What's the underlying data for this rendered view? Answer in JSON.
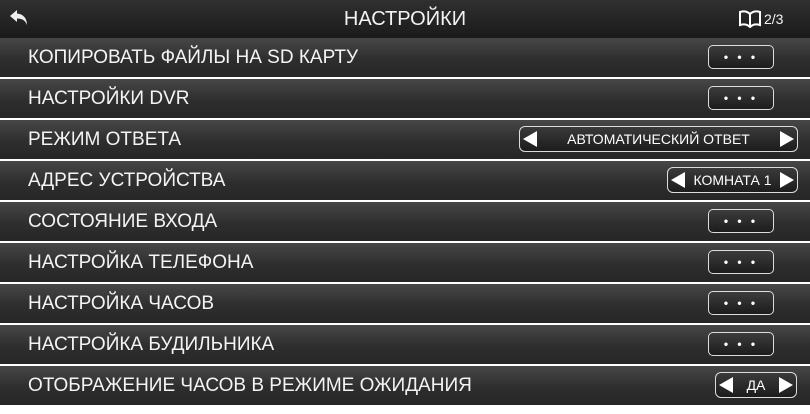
{
  "header": {
    "title": "НАСТРОЙКИ",
    "page_indicator": "2/3",
    "back_icon": "back-arrow-icon",
    "page_icon": "open-book-icon"
  },
  "rows": [
    {
      "label": "КОПИРОВАТЬ ФАЙЛЫ НА SD КАРТУ",
      "button": "• • •"
    },
    {
      "label": "НАСТРОЙКИ DVR",
      "button": "• • •"
    },
    {
      "label": "РЕЖИМ ОТВЕТА",
      "value": "АВТОМАТИЧЕСКИЙ ОТВЕТ"
    },
    {
      "label": "АДРЕС УСТРОЙСТВА",
      "value": "КОМНАТА 1"
    },
    {
      "label": "СОСТОЯНИЕ ВХОДА",
      "button": "• • •"
    },
    {
      "label": "НАСТРОЙКА ТЕЛЕФОНА",
      "button": "• • •"
    },
    {
      "label": "НАСТРОЙКА ЧАСОВ",
      "button": "• • •"
    },
    {
      "label": "НАСТРОЙКА БУДИЛЬНИКА",
      "button": "• • •"
    },
    {
      "label": "ОТОБРАЖЕНИЕ ЧАСОВ В РЕЖИМЕ ОЖИДАНИЯ",
      "value": "ДА"
    }
  ],
  "colors": {
    "header_bg": "#1f1f1f",
    "row_bg": "#333333",
    "text": "#f4f4f4",
    "button_border": "#dcdcdc"
  }
}
